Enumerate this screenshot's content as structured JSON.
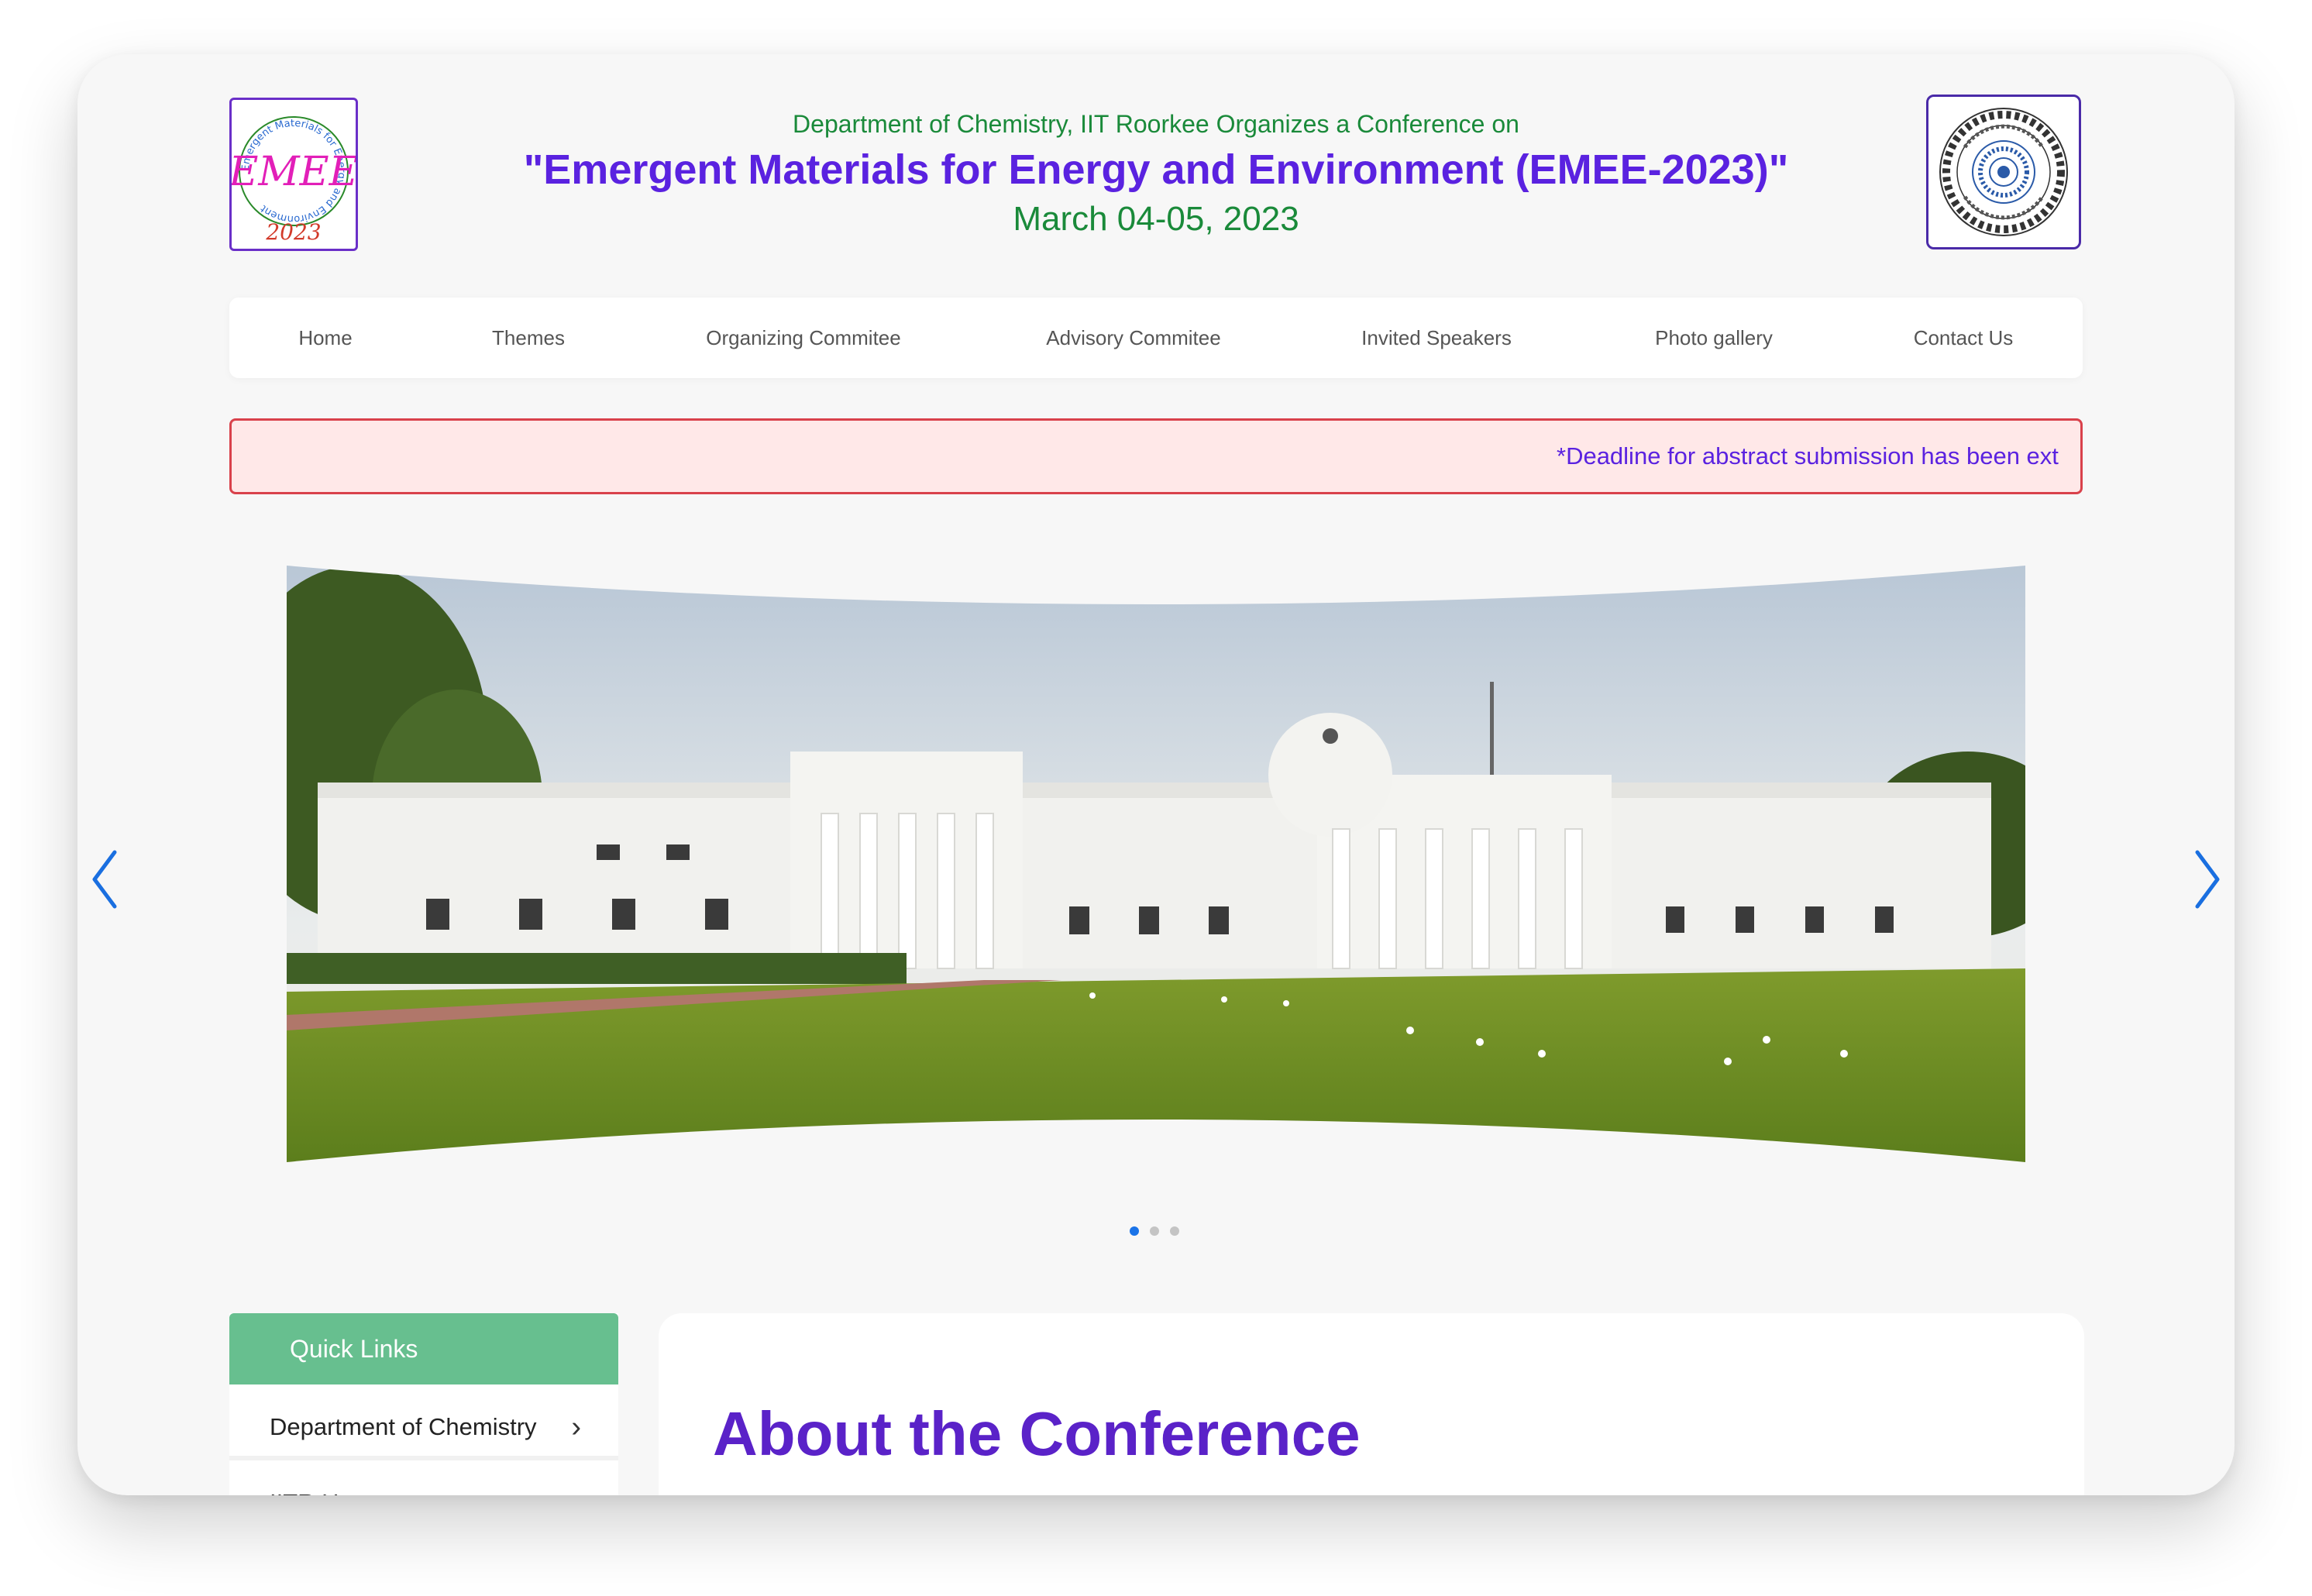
{
  "header": {
    "subtitle": "Department of Chemistry, IIT Roorkee Organizes a Conference on",
    "title": "\"Emergent Materials for Energy and Environment (EMEE-2023)\"",
    "date": "March 04-05, 2023"
  },
  "logo_left": {
    "text": "EMEE",
    "year": "2023",
    "ring_text": "Emergent Materials for Energy and Environment",
    "icon": "emee-logo"
  },
  "logo_right": {
    "icon": "iit-roorkee-emblem"
  },
  "nav": {
    "items": [
      {
        "label": "Home"
      },
      {
        "label": "Themes"
      },
      {
        "label": "Organizing Commitee"
      },
      {
        "label": "Advisory Commitee"
      },
      {
        "label": "Invited Speakers"
      },
      {
        "label": "Photo gallery"
      },
      {
        "label": "Contact Us"
      }
    ]
  },
  "ticker": {
    "text": "*Deadline for abstract submission has been ext"
  },
  "carousel": {
    "slide_count": 3,
    "active_index": 0,
    "image": "iit-roorkee-main-building-photo",
    "prev_icon": "chevron-left-icon",
    "next_icon": "chevron-right-icon"
  },
  "quick_links": {
    "header": "Quick Links",
    "items": [
      {
        "label": "Department of Chemistry"
      },
      {
        "label": "IITR Home"
      }
    ]
  },
  "about": {
    "title": "About the Conference"
  },
  "colors": {
    "title": "#5a22e0",
    "green_text": "#1a8a3a",
    "ticker_bg": "#ffe8e8",
    "ticker_border": "#d9414b",
    "quick_links_header": "#67bf8f",
    "about_title": "#5a22c8",
    "active_dot": "#1a73e8"
  }
}
